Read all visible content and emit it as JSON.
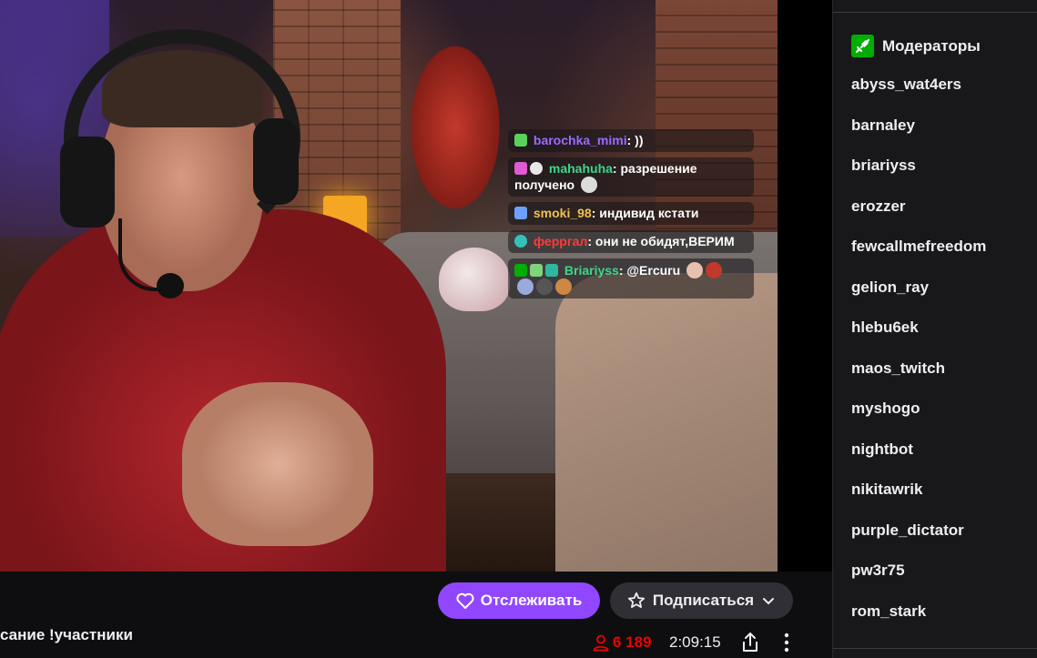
{
  "overlay_chat": {
    "messages": [
      {
        "user": "barochka_mimi",
        "user_color": "#9b6bff",
        "text": ": ))"
      },
      {
        "user": "mahahuha",
        "user_color": "#3fd68a",
        "text": ": разрешение получено"
      },
      {
        "user": "smoki_98",
        "user_color": "#f2c14e",
        "text": ": индивид кстати"
      },
      {
        "user": "ферргал",
        "user_color": "#ff3b3b",
        "text": ": они не обидят,ВЕРИМ"
      },
      {
        "user": "Briariyss",
        "user_color": "#3fd68a",
        "text": ": @Ercuru"
      }
    ]
  },
  "actions": {
    "follow_label": "Отслеживать",
    "subscribe_label": "Подписаться"
  },
  "stream": {
    "title_fragment": "сание !участники",
    "viewer_count": "6 189",
    "uptime": "2:09:15"
  },
  "moderators": {
    "header": "Модераторы",
    "list": [
      "abyss_wat4ers",
      "barnaley",
      "briariyss",
      "erozzer",
      "fewcallmefreedom",
      "gelion_ray",
      "hlebu6ek",
      "maos_twitch",
      "myshogo",
      "nightbot",
      "nikitawrik",
      "purple_dictator",
      "pw3r75",
      "rom_stark"
    ]
  },
  "colors": {
    "accent": "#9147ff",
    "live_red": "#eb0400",
    "mod_green": "#00ad03",
    "background": "#0e0e10",
    "sidebar": "#18181b"
  }
}
